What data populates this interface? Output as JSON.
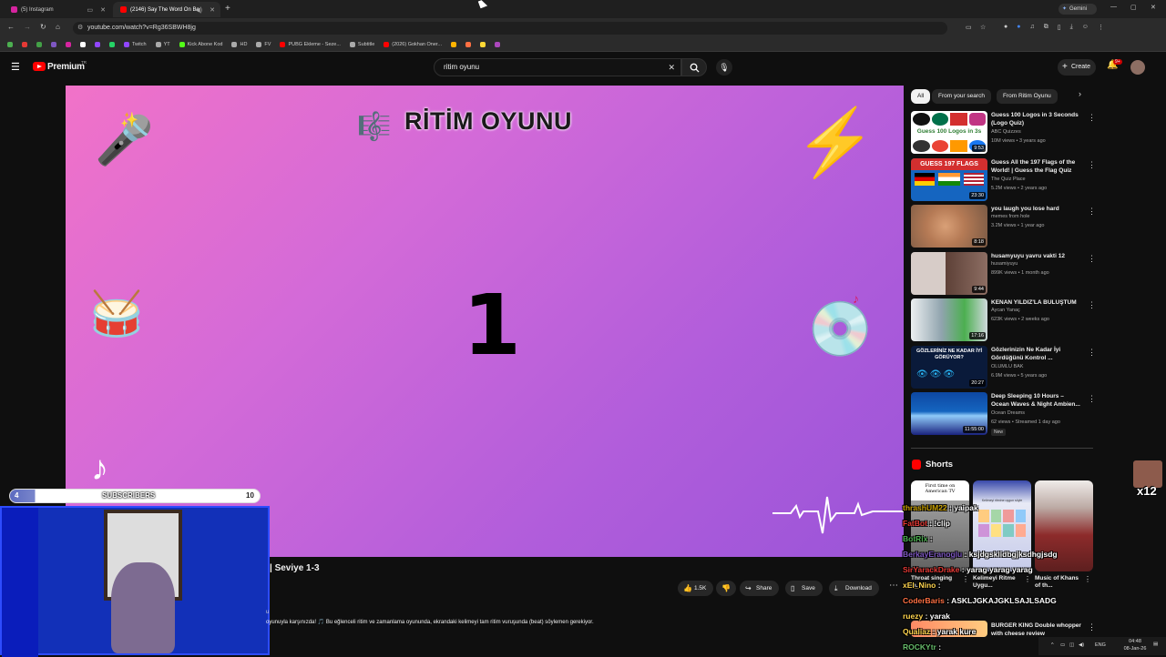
{
  "tabs": [
    {
      "title": "(5) Instagram",
      "active": false
    },
    {
      "title": "(2146) Say The Word On Be",
      "active": true
    }
  ],
  "gemini_label": "Gemini",
  "address": {
    "url": "youtube.com/watch?v=Rg36SBWH8jg"
  },
  "bookmarks": [
    "Twitch",
    "YT",
    "Kick Abone Kod",
    "HD",
    "FV",
    "PUBG Ekleme - Seze...",
    "Subtitle",
    "(2026) Gokhan Oner..."
  ],
  "yt": {
    "logo_text": "Premium",
    "logo_sup": "TR",
    "search_value": "ritim oyunu",
    "create_label": "Create",
    "notif_badge": "9+"
  },
  "video": {
    "overlay_title": "RİTİM OYUNU",
    "counter": "1",
    "subscribers_label": "SUBSCRIBERS",
    "sub_left": "4",
    "sub_right": "10"
  },
  "below_video": {
    "title_fragment": "| Seviye 1-3",
    "description": "oyunuyla karşınızda! 🎵 Bu eğlenceli ritim ve zamanlama oyununda, ekrandaki kelimeyi tam ritim vuruşunda (beat) söylemen gerekiyor.",
    "desc_prefix": "u",
    "likes": "1.5K",
    "share_label": "Share",
    "save_label": "Save",
    "download_label": "Download"
  },
  "chips": [
    "All",
    "From your search",
    "From Ritim Oyunu"
  ],
  "recommendations": [
    {
      "title": "Guess 100 Logos in 3 Seconds (Logo Quiz)",
      "channel": "ABC Quizzes",
      "meta": "10M views • 3 years ago",
      "duration": "9:53",
      "thumb_caption": "Guess 100 Logos in 3s"
    },
    {
      "title": "Guess All the 197 Flags of the World! | Guess the Flag Quiz",
      "channel": "The Quiz Place",
      "meta": "5.2M views • 2 years ago",
      "duration": "23:30",
      "thumb_caption": "GUESS 197 FLAGS"
    },
    {
      "title": "you laugh you lose hard",
      "channel": "memes from hole",
      "meta": "3.2M views • 1 year ago",
      "duration": "8:18"
    },
    {
      "title": "husamyuyu yavru vakti 12",
      "channel": "husamiyuyu",
      "meta": "899K views • 1 month ago",
      "duration": "9:44"
    },
    {
      "title": "KENAN YILDIZ'LA BULUŞTUM",
      "channel": "Aycan Yanaç",
      "meta": "623K views • 2 weeks ago",
      "duration": "17:16"
    },
    {
      "title": "Gözlerinizin Ne Kadar İyi Gördüğünü Kontrol ...",
      "channel": "OLUMLU BAK",
      "meta": "6.9M views • 5 years ago",
      "duration": "20:27",
      "thumb_caption": "GÖZLERİNİZ NE KADAR İYİ GÖRÜYOR?"
    },
    {
      "title": "Deep Sleeping 10 Hours – Ocean Waves & Night Ambien...",
      "channel": "Ocean Dreams",
      "meta": "62 views • Streamed 1 day ago",
      "duration": "11:55:00",
      "badge": "New"
    }
  ],
  "shorts": {
    "heading": "Shorts",
    "items": [
      {
        "title": "Throat singing in...",
        "caption": "First time on American TV"
      },
      {
        "title": "Kelimeyi Ritme Uygu...",
        "caption": "Kelimeyi ritmine uygun söyle"
      },
      {
        "title": "Music of Khans of th..."
      }
    ]
  },
  "chat": [
    {
      "user": "thrashUM22",
      "msg": "yaipak",
      "color": "#c8a000"
    },
    {
      "user": "FatBot",
      "msg": "!clip",
      "color": "#e53935"
    },
    {
      "user": "BotRix",
      "msg": "",
      "color": "#4caf50"
    },
    {
      "user": "BerkayEranoglu",
      "msg": "ksjdgsklidbgjksdhgjsdg",
      "color": "#7e57c2"
    },
    {
      "user": "SirYarackDrake",
      "msg": "yarag yarag yarag",
      "color": "#e53935"
    },
    {
      "user": "xEl_Nino",
      "msg": "",
      "color": "#ffd54f"
    },
    {
      "user": "CoderBaris",
      "msg": "ASKLJGKAJGKLSAJLSADG",
      "color": "#ff7043"
    },
    {
      "user": "ruezy",
      "msg": "yarak",
      "color": "#ffd54f"
    },
    {
      "user": "Qualiaz",
      "msg": "yarak kure",
      "color": "#ffd54f"
    },
    {
      "user": "ROCKYtr",
      "msg": "",
      "color": "#66bb6a"
    }
  ],
  "last_rec": {
    "title": "BURGER KING Double whopper with cheese review"
  },
  "emote_badge": "x12",
  "taskbar": {
    "lang": "ENG",
    "time": "04:48",
    "date": "08-Jan-26"
  }
}
